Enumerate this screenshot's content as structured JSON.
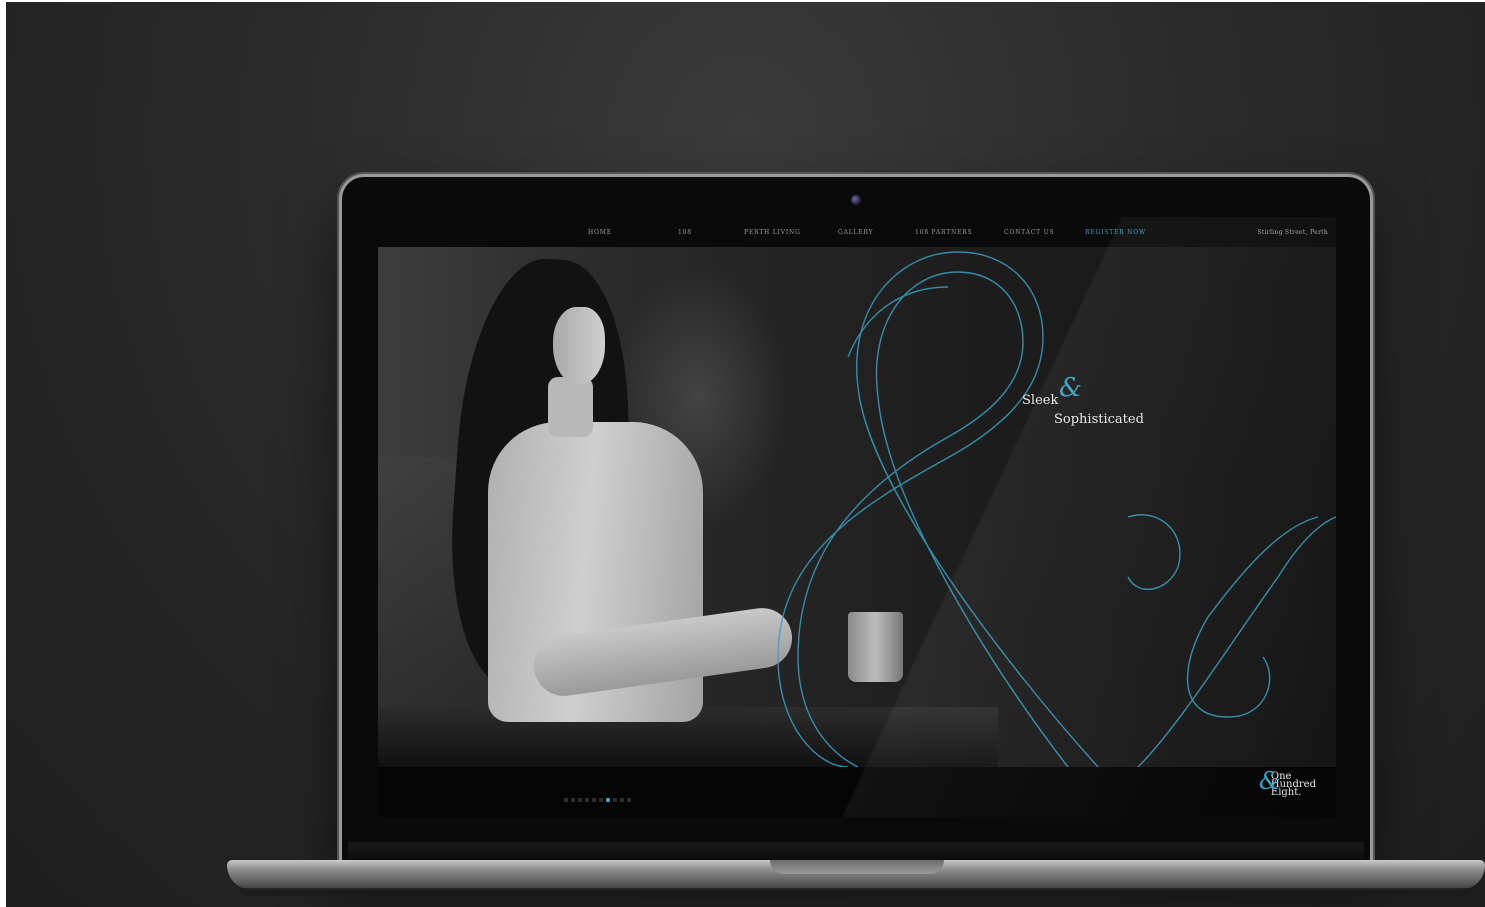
{
  "nav": {
    "items": [
      {
        "label": "HOME",
        "active": false
      },
      {
        "label": "108",
        "active": false
      },
      {
        "label": "PERTH LIVING",
        "active": false
      },
      {
        "label": "GALLERY",
        "active": false
      },
      {
        "label": "108 PARTNERS",
        "active": false
      },
      {
        "label": "CONTACT US",
        "active": false
      },
      {
        "label": "REGISTER NOW",
        "active": true
      }
    ],
    "address": "Stirling Street, Perth"
  },
  "hero": {
    "tagline_line1": "Sleek",
    "tagline_amp": "&",
    "tagline_line2": "Sophisticated"
  },
  "slider": {
    "dot_count": 10,
    "active_index": 6
  },
  "logo": {
    "amp": "&",
    "word1": "One",
    "word2": "Hundred",
    "word3": "Eight."
  },
  "colors": {
    "accent": "#3aa0c0",
    "background": "#2a2a2a",
    "screen": "#050505"
  }
}
